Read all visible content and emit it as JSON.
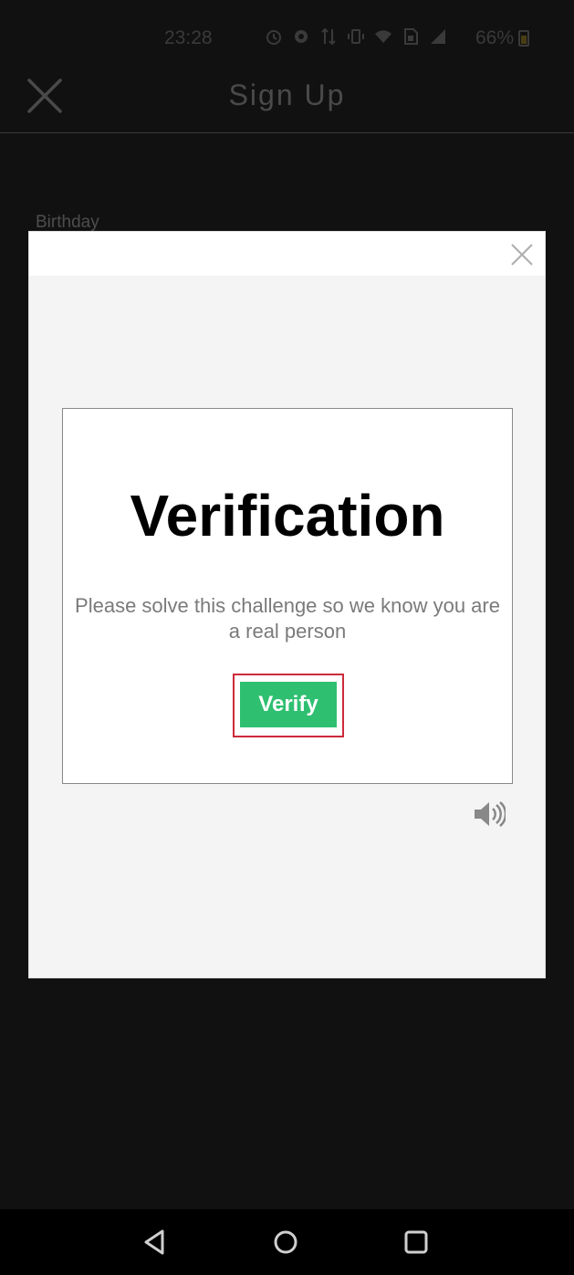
{
  "status_bar": {
    "time": "23:28",
    "battery": "66%",
    "icons": [
      "alarm-icon",
      "data-saver-icon",
      "data-arrows-icon",
      "vibrate-icon",
      "wifi-icon",
      "sim-icon",
      "signal-icon",
      "battery-icon"
    ]
  },
  "header": {
    "title": "Sign Up"
  },
  "form": {
    "birthday_label": "Birthday"
  },
  "dialog": {
    "title": "Verification",
    "description": "Please solve this challenge so we know you are a real person",
    "verify_label": "Verify",
    "verify_color": "#2fbf71",
    "highlight_color": "#cc2a3a"
  },
  "nav": {
    "buttons": [
      "back-icon",
      "home-icon",
      "recents-icon"
    ]
  }
}
